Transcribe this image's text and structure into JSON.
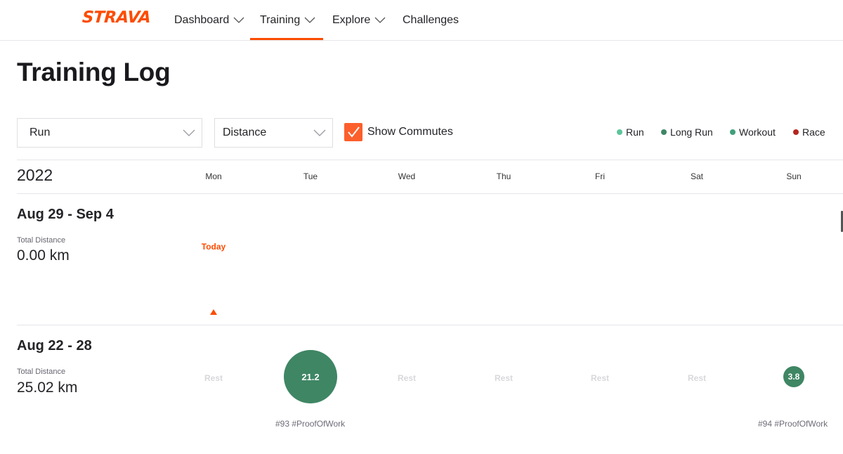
{
  "brand": {
    "logo_text": "STRAVA",
    "color": "#fc4c02"
  },
  "nav": {
    "items": [
      {
        "label": "Dashboard",
        "has_dropdown": true
      },
      {
        "label": "Training",
        "has_dropdown": true,
        "active": true
      },
      {
        "label": "Explore",
        "has_dropdown": true
      },
      {
        "label": "Challenges",
        "has_dropdown": false
      }
    ]
  },
  "page": {
    "title": "Training Log"
  },
  "filters": {
    "sport": {
      "value": "Run"
    },
    "metric": {
      "value": "Distance"
    },
    "show_commutes": {
      "label": "Show Commutes",
      "checked": true
    }
  },
  "legend": [
    {
      "label": "Run",
      "color": "#5cc59a"
    },
    {
      "label": "Long Run",
      "color": "#3f8664"
    },
    {
      "label": "Workout",
      "color": "#40a07a"
    },
    {
      "label": "Race",
      "color": "#b3261e"
    }
  ],
  "calendar": {
    "year": "2022",
    "days": [
      "Mon",
      "Tue",
      "Wed",
      "Thu",
      "Fri",
      "Sat",
      "Sun"
    ],
    "weeks": [
      {
        "range": "Aug 29 - Sep 4",
        "total_label": "Total Distance",
        "total_value": "0.00 km",
        "today_label": "Today"
      },
      {
        "range": "Aug 22 - 28",
        "total_label": "Total Distance",
        "total_value": "25.02 km",
        "rest_label": "Rest",
        "activities": [
          {
            "day": "Tue",
            "value": "21.2",
            "tag": "#93 #ProofOfWork",
            "type": "Long Run"
          },
          {
            "day": "Sun",
            "value": "3.8",
            "tag": "#94 #ProofOfWork",
            "type": "Long Run"
          }
        ]
      }
    ]
  }
}
